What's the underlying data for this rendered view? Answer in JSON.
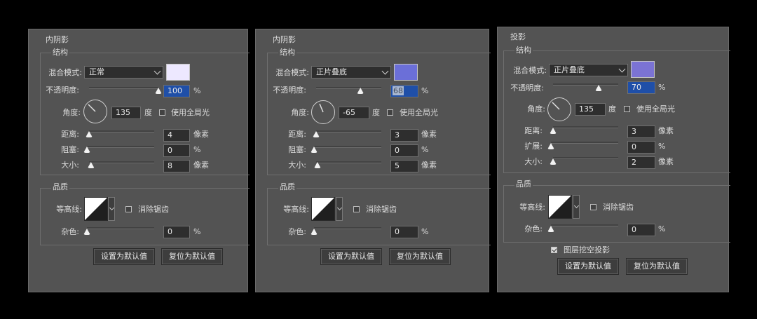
{
  "panels": [
    {
      "section_title": "内阴影",
      "structure": {
        "title": "结构",
        "blend_mode_label": "混合模式:",
        "blend_mode_value": "正常",
        "blend_color": "#ede8ff",
        "opacity_label": "不透明度:",
        "opacity_value": "100",
        "opacity_unit": "%",
        "opacity_fraction": 1.0,
        "angle_label": "角度:",
        "angle_value": "135",
        "angle_unit": "度",
        "global_light_label": "使用全局光",
        "global_light_checked": false,
        "rows": [
          {
            "label": "距离:",
            "value": "4",
            "unit": "像素",
            "fraction": 0.0
          },
          {
            "label": "阻塞:",
            "value": "0",
            "unit": "%",
            "fraction": 0.0
          },
          {
            "label": "大小:",
            "value": "8",
            "unit": "像素",
            "fraction": 0.03
          }
        ]
      },
      "quality": {
        "title": "品质",
        "contour_label": "等高线:",
        "antialias_label": "消除锯齿",
        "antialias_checked": false,
        "noise_label": "杂色:",
        "noise_value": "0",
        "noise_unit": "%"
      },
      "buttons": {
        "set_default": "设置为默认值",
        "reset_default": "复位为默认值"
      }
    },
    {
      "section_title": "内阴影",
      "structure": {
        "title": "结构",
        "blend_mode_label": "混合模式:",
        "blend_mode_value": "正片叠底",
        "blend_color": "#6b6fd8",
        "opacity_label": "不透明度:",
        "opacity_value": "68",
        "opacity_unit": "%",
        "opacity_fraction": 0.68,
        "angle_label": "角度:",
        "angle_value": "-65",
        "angle_unit": "度",
        "global_light_label": "使用全局光",
        "global_light_checked": false,
        "rows": [
          {
            "label": "距离:",
            "value": "3",
            "unit": "像素",
            "fraction": 0.0
          },
          {
            "label": "阻塞:",
            "value": "0",
            "unit": "%",
            "fraction": 0.0
          },
          {
            "label": "大小:",
            "value": "5",
            "unit": "像素",
            "fraction": 0.02
          }
        ]
      },
      "quality": {
        "title": "品质",
        "contour_label": "等高线:",
        "antialias_label": "消除锯齿",
        "antialias_checked": false,
        "noise_label": "杂色:",
        "noise_value": "0",
        "noise_unit": "%"
      },
      "buttons": {
        "set_default": "设置为默认值",
        "reset_default": "复位为默认值"
      }
    },
    {
      "section_title": "投影",
      "structure": {
        "title": "结构",
        "blend_mode_label": "混合模式:",
        "blend_mode_value": "正片叠底",
        "blend_color": "#7b73d4",
        "opacity_label": "不透明度:",
        "opacity_value": "70",
        "opacity_unit": "%",
        "opacity_fraction": 0.7,
        "angle_label": "角度:",
        "angle_value": "135",
        "angle_unit": "度",
        "global_light_label": "使用全局光",
        "global_light_checked": false,
        "rows": [
          {
            "label": "距离:",
            "value": "3",
            "unit": "像素",
            "fraction": 0.0
          },
          {
            "label": "扩展:",
            "value": "0",
            "unit": "%",
            "fraction": 0.0
          },
          {
            "label": "大小:",
            "value": "2",
            "unit": "像素",
            "fraction": 0.0
          }
        ]
      },
      "quality": {
        "title": "品质",
        "contour_label": "等高线:",
        "antialias_label": "消除锯齿",
        "antialias_checked": false,
        "noise_label": "杂色:",
        "noise_value": "0",
        "noise_unit": "%",
        "knockout_label": "图层挖空投影",
        "knockout_checked": true
      },
      "buttons": {
        "set_default": "设置为默认值",
        "reset_default": "复位为默认值"
      }
    }
  ]
}
